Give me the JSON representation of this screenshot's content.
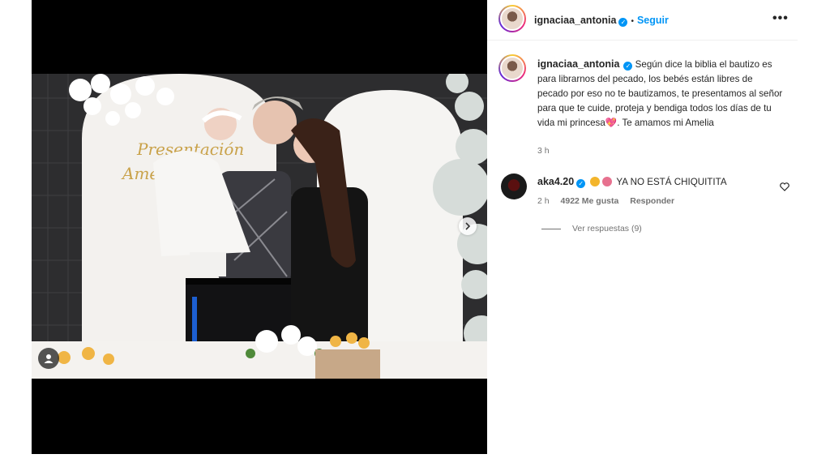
{
  "post": {
    "username": "ignaciaa_antonia",
    "verified": true,
    "follow_label": "Seguir",
    "separator": "•",
    "more_label": "•••"
  },
  "caption": {
    "username": "ignaciaa_antonia",
    "text": "Según dice la biblia el bautizo es para librarnos del pecado, los bebés están libres de pecado por eso no te bautizamos, te presentamos al señor para que te cuide, proteja y bendiga todos los días de tu vida mi princesa",
    "emoji": "💖",
    "text_end": ". Te amamos mi Amelia",
    "time": "3 h"
  },
  "comments": [
    {
      "username": "aka4.20",
      "verified": true,
      "text": "YA NO ESTÁ CHIQUITITA",
      "time": "2 h",
      "likes": "4922 Me gusta",
      "reply_label": "Responder",
      "view_replies": "Ver respuestas (9)"
    }
  ],
  "media": {
    "sign_text_1": "Presentación",
    "sign_text_2": "Amelia"
  },
  "colors": {
    "accent": "#0095f6",
    "muted": "#737373",
    "text": "#262626"
  }
}
